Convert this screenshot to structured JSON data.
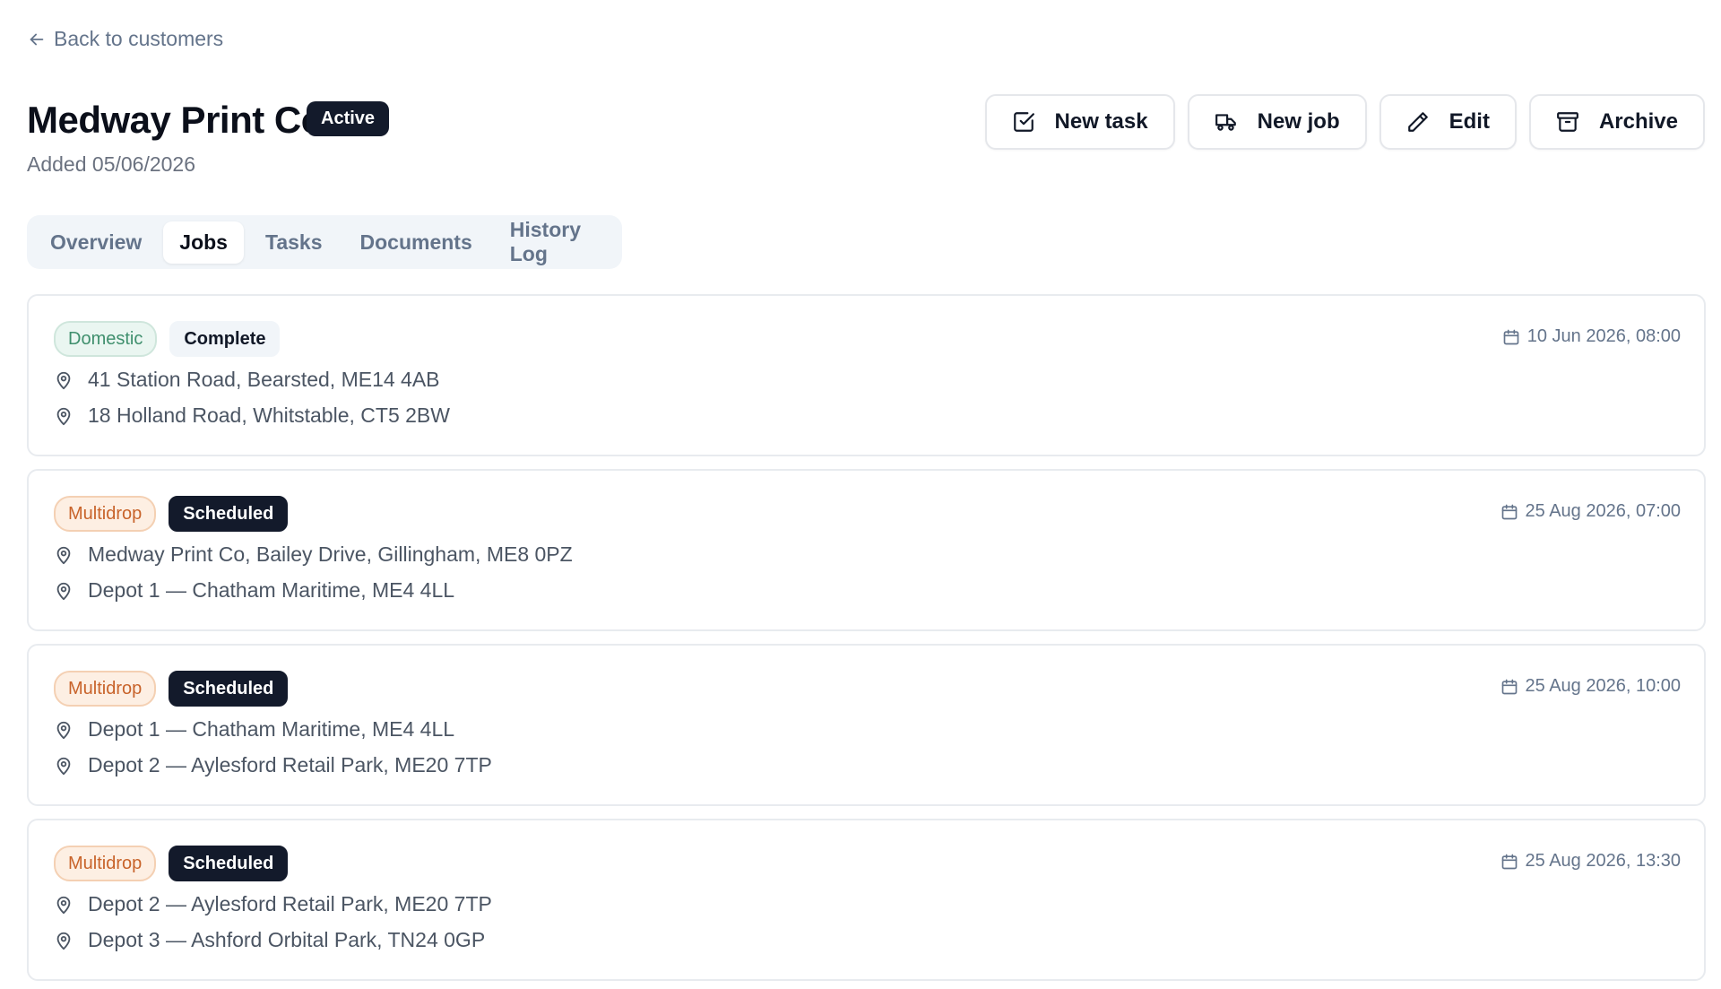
{
  "nav": {
    "back_label": "Back to customers"
  },
  "header": {
    "title": "Medway Print Co",
    "status": "Active",
    "added": "Added 05/06/2026"
  },
  "actions": [
    {
      "label": "New task",
      "icon": "checkbox-icon"
    },
    {
      "label": "New job",
      "icon": "truck-icon"
    },
    {
      "label": "Edit",
      "icon": "pencil-icon"
    },
    {
      "label": "Archive",
      "icon": "archive-icon"
    }
  ],
  "tabs": [
    {
      "label": "Overview",
      "active": false
    },
    {
      "label": "Jobs",
      "active": true
    },
    {
      "label": "Tasks",
      "active": false
    },
    {
      "label": "Documents",
      "active": false
    },
    {
      "label": "History Log",
      "active": false
    }
  ],
  "jobs": [
    {
      "type": "Domestic",
      "status": "Complete",
      "date": "10 Jun 2026, 08:00",
      "from": "41 Station Road, Bearsted, ME14 4AB",
      "to": "18 Holland Road, Whitstable, CT5 2BW"
    },
    {
      "type": "Multidrop",
      "status": "Scheduled",
      "date": "25 Aug 2026, 07:00",
      "from": "Medway Print Co, Bailey Drive, Gillingham, ME8 0PZ",
      "to": "Depot 1 — Chatham Maritime, ME4 4LL"
    },
    {
      "type": "Multidrop",
      "status": "Scheduled",
      "date": "25 Aug 2026, 10:00",
      "from": "Depot 1 — Chatham Maritime, ME4 4LL",
      "to": "Depot 2 — Aylesford Retail Park, ME20 7TP"
    },
    {
      "type": "Multidrop",
      "status": "Scheduled",
      "date": "25 Aug 2026, 13:30",
      "from": "Depot 2 — Aylesford Retail Park, ME20 7TP",
      "to": "Depot 3 — Ashford Orbital Park, TN24 0GP"
    }
  ],
  "colors": {
    "status_dark": "#131a2b",
    "domestic_text": "#3f8f6d",
    "multidrop_text": "#c8632a",
    "muted_text": "#64748b"
  }
}
